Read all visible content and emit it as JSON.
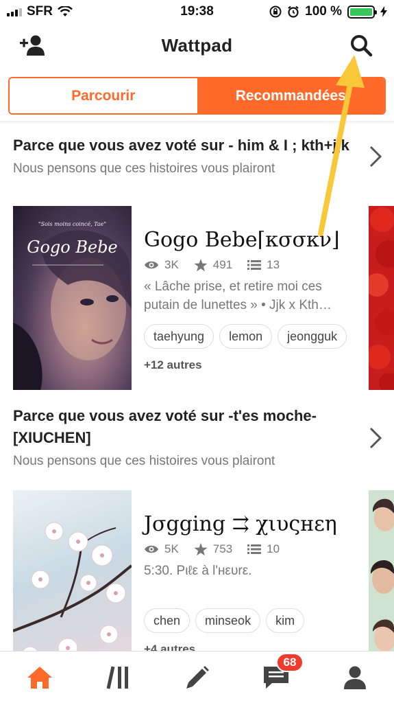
{
  "status_bar": {
    "carrier": "SFR",
    "time": "19:38",
    "battery": "100 %"
  },
  "header": {
    "title": "Wattpad",
    "add_friend_icon": "add-person-icon",
    "search_icon": "search-icon"
  },
  "tabs": [
    {
      "label": "Parcourir",
      "active": false
    },
    {
      "label": "Recommandées",
      "active": true
    }
  ],
  "sections": [
    {
      "title": "Parce que vous avez voté sur - him & I ; kth+jjk",
      "subtitle": "Nous pensons que ces histoires vous plairont",
      "story": {
        "cover_text": "Gogo Bebe",
        "cover_caption": "\"Sois moins coincé, Tae\"",
        "title": "Gogo Bebe⌈κσσκν⌋",
        "reads": "3K",
        "votes": "491",
        "parts": "13",
        "description": "« Lâche prise, et retire moi ces putain de lunettes » • Jjk x Kth…",
        "tags": [
          "taehyung",
          "lemon",
          "jeongguk"
        ],
        "more": "+12 autres"
      }
    },
    {
      "title": "Parce que vous avez voté sur -t'es moche- [XIUCHEN]",
      "subtitle": "Nous pensons que ces histoires vous plairont",
      "story": {
        "title": "Jσgging ⇉ χιυςнεη",
        "reads": "5K",
        "votes": "753",
        "parts": "10",
        "description": "5:30. Pιℓε à l'нευrε.",
        "tags": [
          "chen",
          "minseok",
          "kim"
        ],
        "more": "+4 autres"
      }
    }
  ],
  "bottom_nav": {
    "items": [
      "home-icon",
      "library-icon",
      "write-icon",
      "messages-icon",
      "profile-icon"
    ],
    "notifications_badge": "68"
  },
  "colors": {
    "accent": "#ff6a2b",
    "annotation_arrow": "#f9c83a"
  }
}
